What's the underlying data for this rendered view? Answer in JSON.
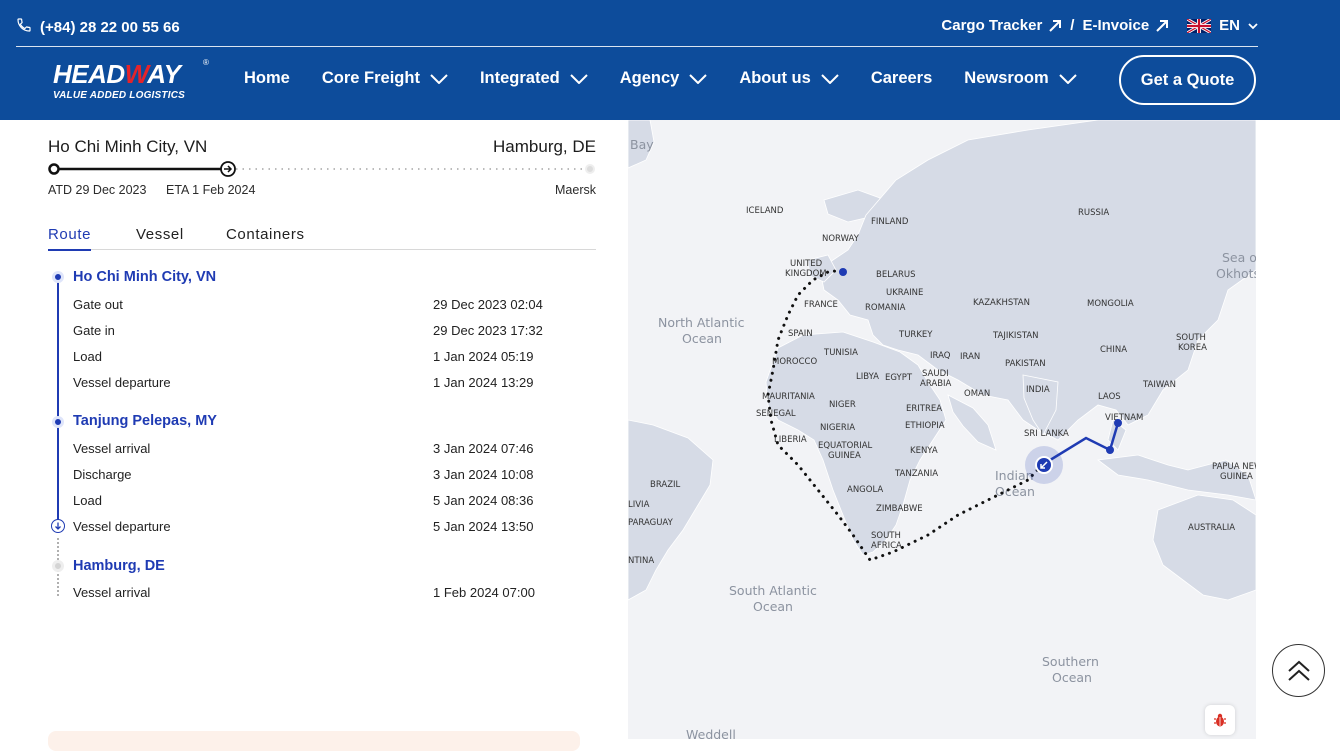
{
  "header": {
    "phone": "(+84) 28 22 00 55 66",
    "cargo_tracker": "Cargo Tracker",
    "separator": "/",
    "e_invoice": "E-Invoice",
    "language": "EN",
    "logo_brand_a": "HEAD",
    "logo_brand_w": "W",
    "logo_brand_b": "AY",
    "logo_tagline": "VALUE ADDED LOGISTICS",
    "logo_reg": "®",
    "nav": [
      {
        "label": "Home"
      },
      {
        "label": "Core Freight"
      },
      {
        "label": "Integrated"
      },
      {
        "label": "Agency"
      },
      {
        "label": "About us"
      },
      {
        "label": "Careers"
      },
      {
        "label": "Newsroom"
      }
    ],
    "quote_button": "Get a Quote",
    "brand_color": "#0d4c9b"
  },
  "shipment": {
    "origin": "Ho Chi Minh City, VN",
    "destination": "Hamburg, DE",
    "atd": "ATD 29 Dec 2023",
    "eta": "ETA 1 Feb 2024",
    "carrier": "Maersk",
    "progress_fraction": 0.33
  },
  "tabs": [
    {
      "label": "Route",
      "active": true
    },
    {
      "label": "Vessel",
      "active": false
    },
    {
      "label": "Containers",
      "active": false
    }
  ],
  "route": [
    {
      "port": "Ho Chi Minh City, VN",
      "events": [
        {
          "name": "Gate out",
          "time": "29 Dec 2023 02:04"
        },
        {
          "name": "Gate in",
          "time": "29 Dec 2023 17:32"
        },
        {
          "name": "Load",
          "time": "1 Jan 2024 05:19"
        },
        {
          "name": "Vessel departure",
          "time": "1 Jan 2024 13:29"
        }
      ]
    },
    {
      "port": "Tanjung Pelepas, MY",
      "events": [
        {
          "name": "Vessel arrival",
          "time": "3 Jan 2024 07:46"
        },
        {
          "name": "Discharge",
          "time": "3 Jan 2024 10:08"
        },
        {
          "name": "Load",
          "time": "5 Jan 2024 08:36"
        },
        {
          "name": "Vessel departure",
          "time": "5 Jan 2024 13:50"
        }
      ]
    },
    {
      "port": "Hamburg, DE",
      "events": [
        {
          "name": "Vessel arrival",
          "time": "1 Feb 2024 07:00"
        }
      ]
    }
  ],
  "map": {
    "oceans": {
      "north_atlantic_1": "North Atlantic",
      "north_atlantic_2": "Ocean",
      "south_atlantic_1": "South Atlantic",
      "south_atlantic_2": "Ocean",
      "indian_1": "Indian",
      "indian_2": "Ocean",
      "southern_1": "Southern",
      "southern_2": "Ocean",
      "sea_okhotsk_1": "Sea o",
      "sea_okhotsk_2": "Okhots",
      "bay": "Bay",
      "weddell": "Weddell"
    },
    "countries": {
      "iceland": "ICELAND",
      "finland": "FINLAND",
      "norway": "NORWAY",
      "russia": "RUSSIA",
      "uk_1": "UNITED",
      "uk_2": "KINGDOM",
      "belarus": "BELARUS",
      "ukraine": "UKRAINE",
      "france": "FRANCE",
      "romania": "ROMANIA",
      "kazakhstan": "KAZAKHSTAN",
      "mongolia": "MONGOLIA",
      "spain": "SPAIN",
      "turkey": "TURKEY",
      "tajikistan": "TAJIKISTAN",
      "south_korea_1": "SOUTH",
      "south_korea_2": "KOREA",
      "china": "CHINA",
      "tunisia": "TUNISIA",
      "iraq": "IRAQ",
      "iran": "IRAN",
      "morocco": "MOROCCO",
      "pakistan": "PAKISTAN",
      "libya": "LIBYA",
      "egypt": "EGYPT",
      "saudi_1": "SAUDI",
      "saudi_2": "ARABIA",
      "taiwan": "TAIWAN",
      "india": "INDIA",
      "laos": "LAOS",
      "mauritania": "MAURITANIA",
      "oman": "OMAN",
      "niger": "NIGER",
      "vietnam": "VIETNAM",
      "senegal": "SENEGAL",
      "eritrea": "ERITREA",
      "nigeria": "NIGERIA",
      "ethiopia": "ETHIOPIA",
      "liberia": "LIBERIA",
      "sri_lanka": "SRI LANKA",
      "eq_guinea_1": "EQUATORIAL",
      "eq_guinea_2": "GUINEA",
      "kenya": "KENYA",
      "png_1": "PAPUA NEW",
      "png_2": "GUINEA",
      "tanzania": "TANZANIA",
      "brazil": "BRAZIL",
      "angola": "ANGOLA",
      "zimbabwe": "ZIMBABWE",
      "bolivia": "LIVIA",
      "paraguay": "PARAGUAY",
      "australia": "AUSTRALIA",
      "south_africa_1": "SOUTH",
      "south_africa_2": "AFRICA",
      "argentina": "NTINA"
    },
    "route_color": "#1f3bb3"
  }
}
